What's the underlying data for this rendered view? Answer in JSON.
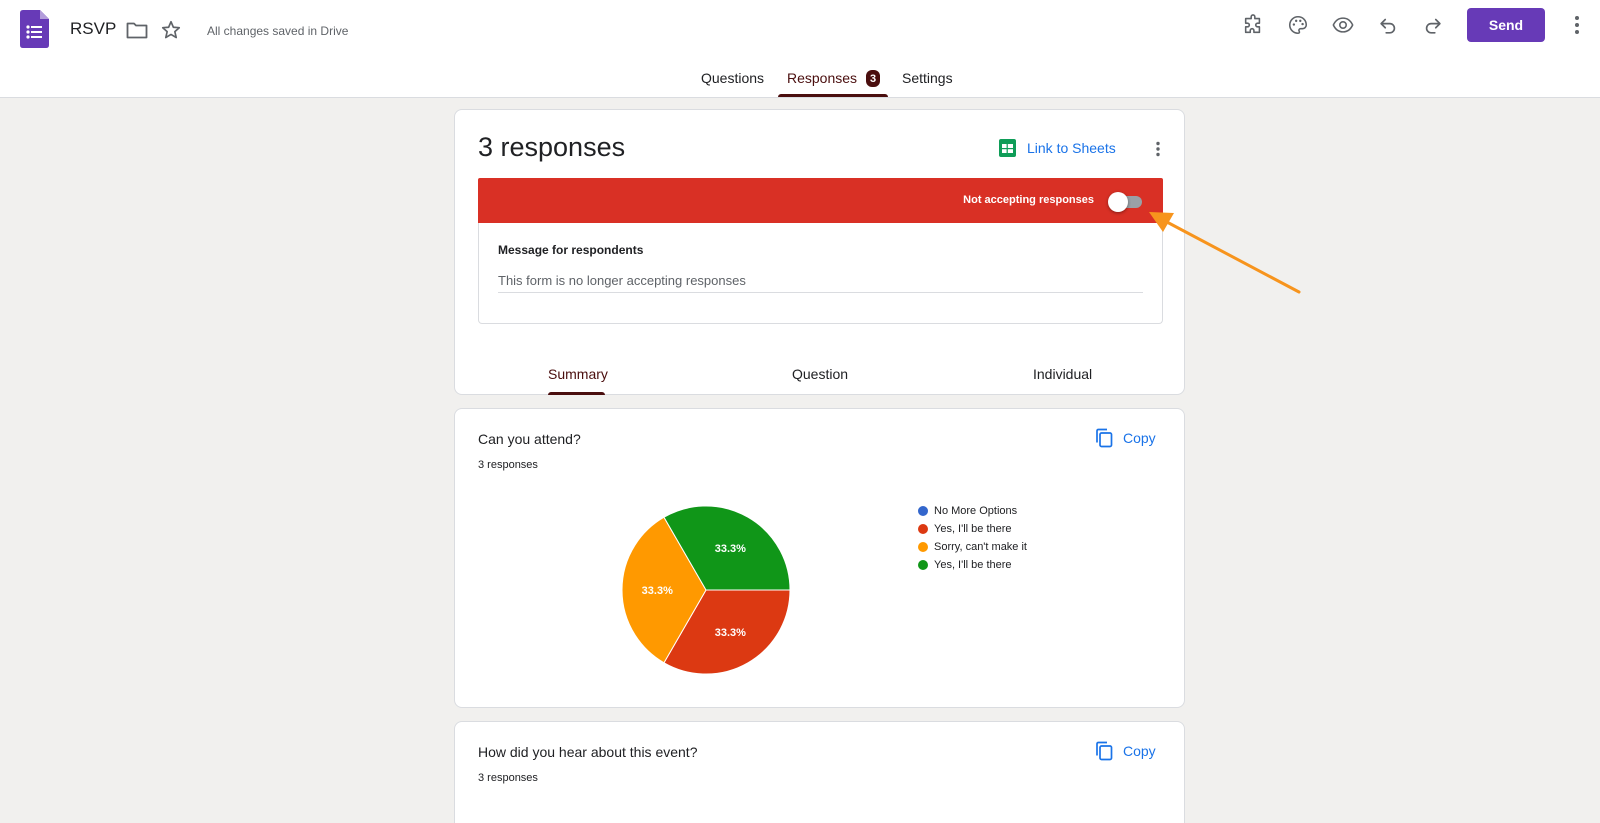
{
  "header": {
    "doc_title": "RSVP",
    "saved_status": "All changes saved in Drive",
    "send_label": "Send",
    "tabs": [
      {
        "label": "Questions"
      },
      {
        "label": "Responses",
        "badge": "3"
      },
      {
        "label": "Settings"
      }
    ],
    "icons": [
      "forms-logo",
      "folder-icon",
      "star-icon",
      "addons-icon",
      "palette-icon",
      "preview-eye-icon",
      "undo-icon",
      "redo-icon",
      "more-vert-icon"
    ],
    "accent_color": "#673ab7"
  },
  "responses_card": {
    "title": "3 responses",
    "link_sheets_label": "Link to Sheets",
    "banner_text": "Not accepting responses",
    "banner_color": "#d93025",
    "accepting": false,
    "message_label": "Message for respondents",
    "message_value": "This form is no longer accepting responses",
    "subtabs": [
      {
        "label": "Summary"
      },
      {
        "label": "Question"
      },
      {
        "label": "Individual"
      }
    ]
  },
  "question_cards": [
    {
      "title": "Can you attend?",
      "count": "3 responses",
      "copy_label": "Copy"
    },
    {
      "title": "How did you hear about this event?",
      "count": "3 responses",
      "copy_label": "Copy"
    }
  ],
  "chart_data": {
    "type": "pie",
    "legend": [
      {
        "label": "No More Options",
        "color": "#3366cc"
      },
      {
        "label": "Yes, I'll be there",
        "color": "#dc3912"
      },
      {
        "label": "Sorry, can't make it",
        "color": "#ff9900"
      },
      {
        "label": "Yes, I'll be there",
        "color": "#109618"
      }
    ],
    "slices": [
      {
        "label": "Yes, I'll be there",
        "value": 33.3,
        "color": "#dc3912",
        "display": "33.3%"
      },
      {
        "label": "Sorry, can't make it",
        "value": 33.3,
        "color": "#ff9900",
        "display": "33.3%"
      },
      {
        "label": "Yes, I'll be there",
        "value": 33.3,
        "color": "#109618",
        "display": "33.3%"
      }
    ]
  }
}
